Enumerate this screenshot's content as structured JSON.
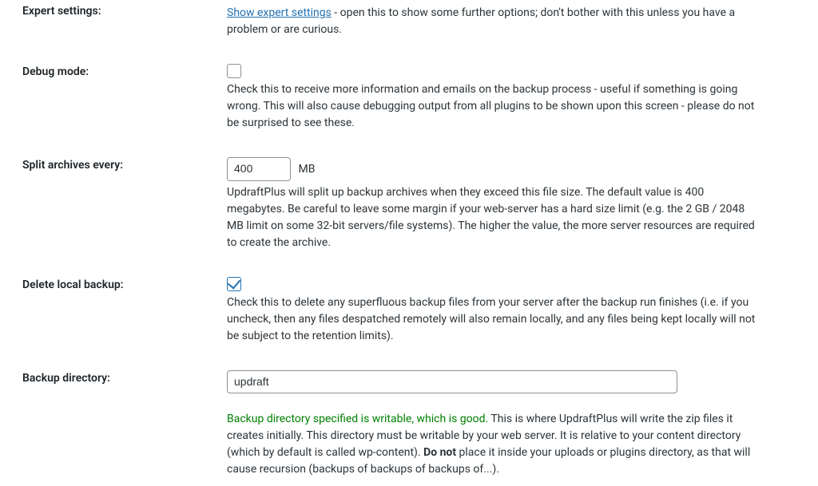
{
  "rows": {
    "expert_settings": {
      "label": "Expert settings:",
      "link_text": "Show expert settings",
      "description_suffix": " - open this to show some further options; don't bother with this unless you have a problem or are curious."
    },
    "debug_mode": {
      "label": "Debug mode:",
      "checked": false,
      "description": "Check this to receive more information and emails on the backup process - useful if something is going wrong. This will also cause debugging output from all plugins to be shown upon this screen - please do not be surprised to see these."
    },
    "split_archives": {
      "label": "Split archives every:",
      "value": "400",
      "unit": "MB",
      "description": "UpdraftPlus will split up backup archives when they exceed this file size. The default value is 400 megabytes. Be careful to leave some margin if your web-server has a hard size limit (e.g. the 2 GB / 2048 MB limit on some 32-bit servers/file systems). The higher the value, the more server resources are required to create the archive."
    },
    "delete_local": {
      "label": "Delete local backup:",
      "checked": true,
      "description": "Check this to delete any superfluous backup files from your server after the backup run finishes (i.e. if you uncheck, then any files despatched remotely will also remain locally, and any files being kept locally will not be subject to the retention limits)."
    },
    "backup_directory": {
      "label": "Backup directory:",
      "value": "updraft",
      "status_prefix_success": "Backup directory specified is writable, which is good.",
      "status_middle": " This is where UpdraftPlus will write the zip files it creates initially. This directory must be writable by your web server. It is relative to your content directory (which by default is called wp-content). ",
      "do_not": "Do not",
      "status_suffix": " place it inside your uploads or plugins directory, as that will cause recursion (backups of backups of backups of...)."
    }
  }
}
